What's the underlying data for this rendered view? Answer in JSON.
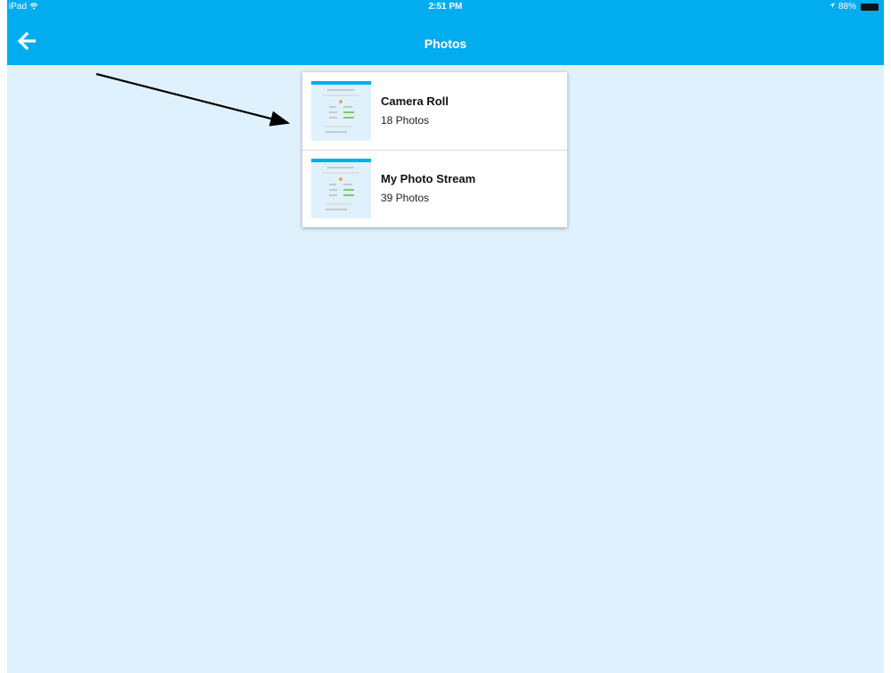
{
  "status_bar": {
    "device": "iPad",
    "time": "2:51 PM",
    "battery": "88%"
  },
  "nav": {
    "title": "Photos",
    "back_icon": "back-arrow-icon"
  },
  "albums": [
    {
      "name": "Camera Roll",
      "count": "18 Photos"
    },
    {
      "name": "My Photo Stream",
      "count": "39 Photos"
    }
  ],
  "colors": {
    "accent": "#02adef",
    "background": "#dff1fc",
    "card": "#ffffff",
    "annotation_arrow": "#000000"
  }
}
